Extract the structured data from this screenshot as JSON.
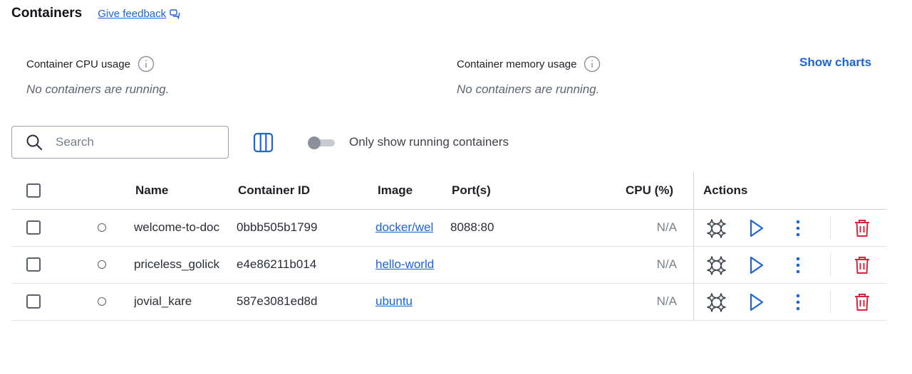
{
  "header": {
    "title": "Containers",
    "feedback_label": "Give feedback"
  },
  "usage": {
    "cpu": {
      "label": "Container CPU usage",
      "status": "No containers are running."
    },
    "memory": {
      "label": "Container memory usage",
      "status": "No containers are running."
    },
    "show_charts_label": "Show charts"
  },
  "toolbar": {
    "search_placeholder": "Search",
    "search_value": "",
    "running_only_label": "Only show running containers",
    "running_only_enabled": false
  },
  "table": {
    "columns": [
      "Name",
      "Container ID",
      "Image",
      "Port(s)",
      "CPU (%)",
      "Actions"
    ],
    "rows": [
      {
        "name": "welcome-to-doc",
        "id": "0bbb505b1799",
        "image": "docker/wel",
        "ports": "8088:80",
        "cpu": "N/A",
        "status": "stopped"
      },
      {
        "name": "priceless_golick",
        "id": "e4e86211b014",
        "image": "hello-world",
        "ports": "",
        "cpu": "N/A",
        "status": "stopped"
      },
      {
        "name": "jovial_kare",
        "id": "587e3081ed8d",
        "image": "ubuntu",
        "ports": "",
        "cpu": "N/A",
        "status": "stopped"
      }
    ]
  },
  "icons": {
    "feedback": "chat-bubble-icon",
    "info": "info-icon",
    "search": "search-icon",
    "columns": "columns-icon",
    "ai": "sparkle-icon",
    "start": "play-icon",
    "more": "more-vertical-icon",
    "delete": "trash-icon"
  },
  "colors": {
    "accent": "#1e64d6",
    "danger": "#d3273e",
    "muted": "#7a808a"
  }
}
